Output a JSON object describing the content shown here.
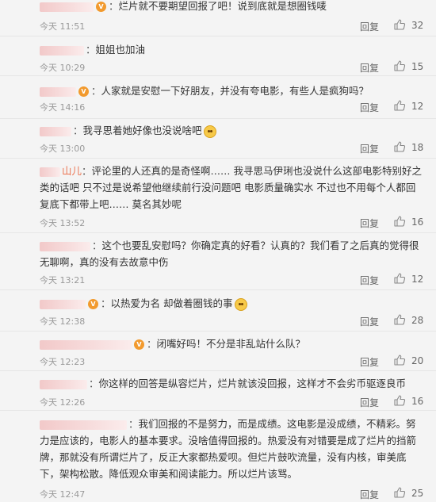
{
  "actions": {
    "reply_label": "回复"
  },
  "comments": [
    {
      "text": "烂片就不要期望回报了吧！说到底就是想圈钱唛",
      "time": "今天 11:51",
      "likes": "32"
    },
    {
      "text": "姐姐也加油",
      "time": "今天 10:29",
      "likes": "15"
    },
    {
      "text": "人家就是安慰一下好朋友，并没有夸电影，有些人是疯狗吗？",
      "time": "今天 14:16",
      "likes": "12"
    },
    {
      "text": "我寻思着她好像也没说啥吧",
      "time": "今天 13:00",
      "likes": "18"
    },
    {
      "user": "山儿",
      "text": "评论里的人还真的是奇怪啊…… 我寻思马伊琍也没说什么这部电影特别好之类的话吧 只不过是说希望他继续前行没问题吧 电影质量确实水 不过也不用每个人都回复底下都带上吧…… 莫名其妙呢",
      "time": "今天 13:52",
      "likes": "16"
    },
    {
      "text": "这个也要乱安慰吗？你确定真的好看？认真的？我们看了之后真的觉得很无聊啊，真的没有去故意中伤",
      "time": "今天 13:21",
      "likes": "12"
    },
    {
      "text": "以热爱为名 却做着圈钱的事",
      "time": "今天 12:38",
      "likes": "28"
    },
    {
      "text": "闭嘴好吗！不分是非乱站什么队？",
      "time": "今天 12:23",
      "likes": "20"
    },
    {
      "text": "你这样的回答是纵容烂片，烂片就该没回报，这样才不会劣币驱逐良币",
      "time": "今天 12:26",
      "likes": "16"
    },
    {
      "text": "我们回报的不是努力，而是成绩。这电影是没成绩，不精彩。努力是应该的，电影人的基本要求。没啥值得回报的。热爱没有对错要是成了烂片的挡箭牌，那就没有所谓烂片了，反正大家都热爱呗。但烂片鼓吹流量，没有内核，审美底下，架构松散。降低观众审美和阅读能力。所以烂片该骂。",
      "time": "今天 12:47",
      "likes": "25"
    }
  ]
}
